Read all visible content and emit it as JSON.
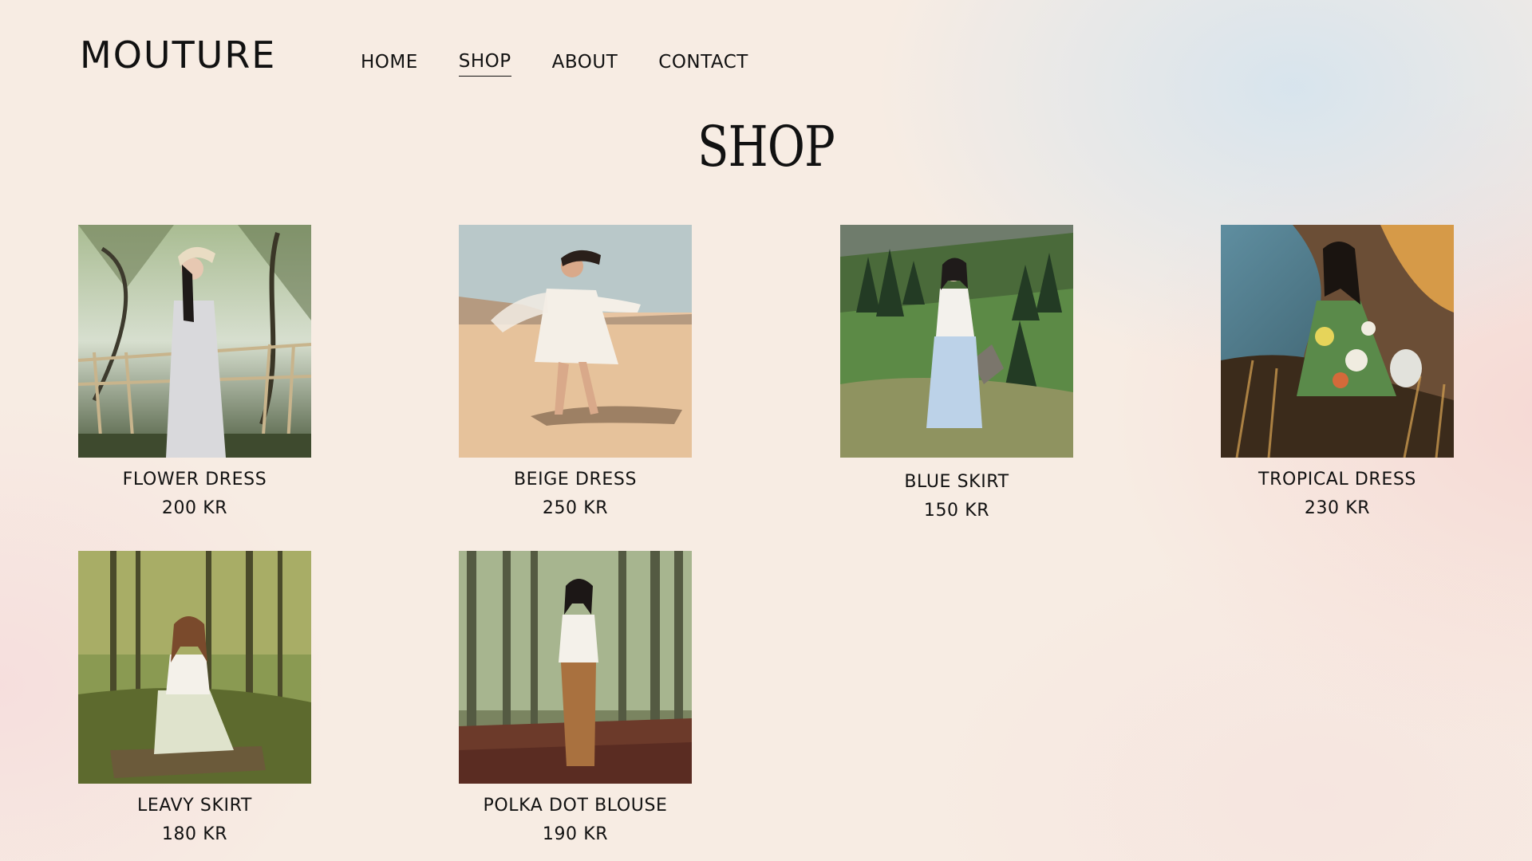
{
  "header": {
    "brand": "MOUTURE",
    "nav": [
      {
        "label": "HOME"
      },
      {
        "label": "SHOP"
      },
      {
        "label": "ABOUT"
      },
      {
        "label": "CONTACT"
      }
    ]
  },
  "main": {
    "title": "SHOP",
    "products": [
      {
        "name": "FLOWER DRESS",
        "price": "200 KR"
      },
      {
        "name": "BEIGE DRESS",
        "price": "250 KR"
      },
      {
        "name": "BLUE SKIRT",
        "price": "150 KR"
      },
      {
        "name": "TROPICAL DRESS",
        "price": "230 KR"
      },
      {
        "name": "LEAVY SKIRT",
        "price": "180 KR"
      },
      {
        "name": "POLKA DOT BLOUSE",
        "price": "190 KR"
      }
    ]
  }
}
